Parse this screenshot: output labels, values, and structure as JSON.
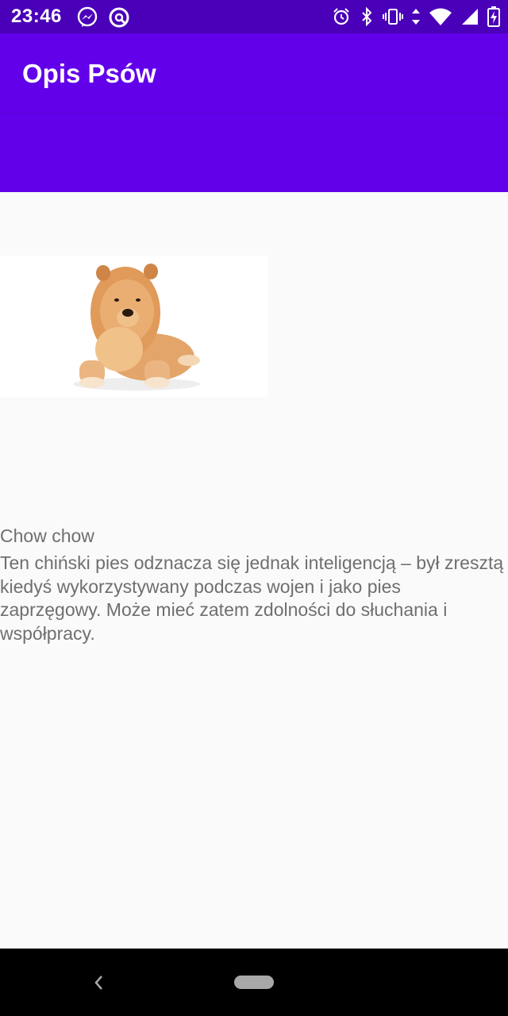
{
  "status_bar": {
    "time": "23:46",
    "left_icons": [
      "messenger-icon",
      "blocked-icon"
    ],
    "right_icons": [
      "alarm-icon",
      "bluetooth-icon",
      "vibrate-icon",
      "data-arrows-icon",
      "wifi-icon",
      "signal-icon",
      "battery-charging-icon"
    ]
  },
  "app_bar": {
    "title": "Opis Psów"
  },
  "dog": {
    "image_icon": "chow-chow-dog-photo",
    "name": "Chow chow",
    "description": "Ten chiński pies odznacza się jednak inteligencją – był zresztą kiedyś wykorzystywany podczas wojen i jako pies zaprzęgowy. Może mieć zatem zdolności do słuchania i współpracy."
  },
  "nav_bar": {
    "icons": [
      "back-icon",
      "home-pill-icon"
    ]
  },
  "colors": {
    "status_bar": "#4a00b8",
    "app_bar": "#6200ea",
    "background": "#fafafa",
    "text": "#6f6f6f"
  }
}
